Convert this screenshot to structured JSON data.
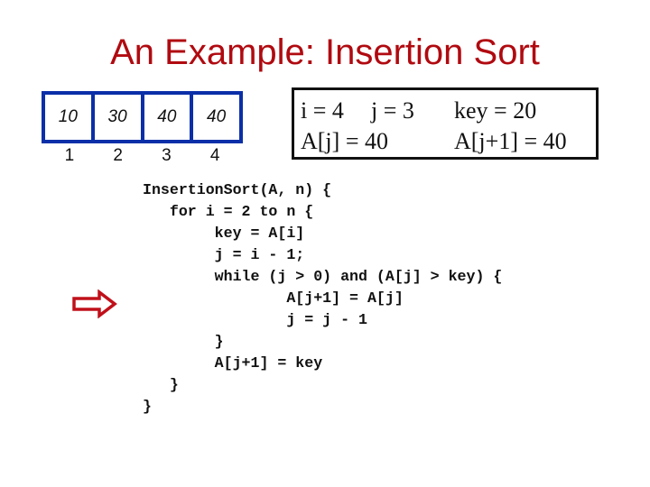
{
  "slide": {
    "title": "An Example: Insertion Sort"
  },
  "array": {
    "values": [
      "10",
      "30",
      "40",
      "40"
    ],
    "indices": [
      "1",
      "2",
      "3",
      "4"
    ],
    "border_color": "#0a2fa8"
  },
  "variables": {
    "i": "i = 4",
    "j": "j = 3",
    "key": "key = 20",
    "a_j": "A[j] = 40",
    "a_j1": "A[j+1] = 40"
  },
  "code": {
    "lines": [
      "InsertionSort(A, n) {",
      "   for i = 2 to n {",
      "        key = A[i]",
      "        j = i - 1;",
      "        while (j > 0) and (A[j] > key) {",
      "                A[j+1] = A[j]",
      "                j = j - 1",
      "        }",
      "        A[j+1] = key",
      "   }",
      "}"
    ],
    "current_line_marker": "arrow-icon",
    "current_line_index": 5
  },
  "colors": {
    "title": "#b00a10",
    "arrow": "#c0101a",
    "text": "#111111"
  }
}
